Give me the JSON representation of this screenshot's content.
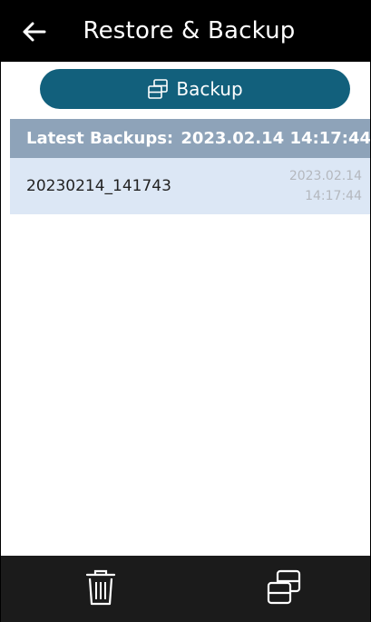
{
  "header": {
    "title": "Restore & Backup",
    "back_icon": "arrow-left-icon"
  },
  "backup_button": {
    "label": "Backup",
    "icon": "backup-icon",
    "color": "#12607c"
  },
  "latest": {
    "label": "Latest Backups:",
    "value": "2023.02.14 14:17:44",
    "color": "#8ea3b9"
  },
  "backups": [
    {
      "name": "20230214_141743",
      "date": "2023.02.14",
      "time": "14:17:44",
      "selected": true
    }
  ],
  "bottom_bar": {
    "delete_icon": "trash-icon",
    "restore_icon": "restore-icon",
    "color": "#1b1b1b"
  }
}
